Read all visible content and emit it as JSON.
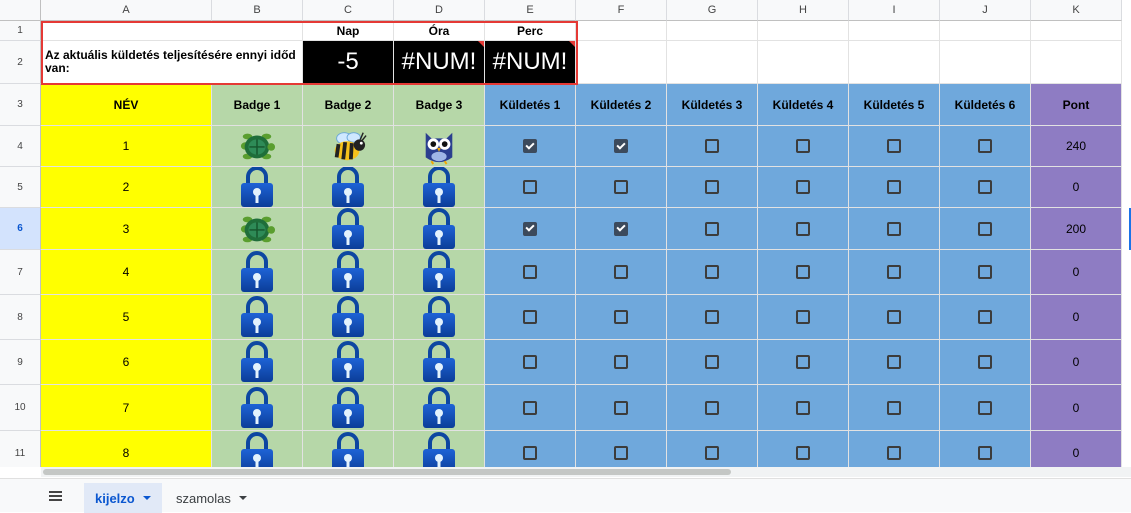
{
  "columns": [
    "A",
    "B",
    "C",
    "D",
    "E",
    "F",
    "G",
    "H",
    "I",
    "J",
    "K"
  ],
  "row_numbers": [
    "1",
    "2",
    "3",
    "4",
    "5",
    "6",
    "7",
    "8",
    "9",
    "10",
    "11"
  ],
  "selected_row": "6",
  "timer": {
    "prompt": "Az aktuális küldetés teljesítésére ennyi időd van:",
    "headers": [
      "Nap",
      "Óra",
      "Perc"
    ],
    "values": [
      "-5",
      "#NUM!",
      "#NUM!"
    ]
  },
  "table_headers": [
    "NÉV",
    "Badge 1",
    "Badge 2",
    "Badge 3",
    "Küldetés 1",
    "Küldetés 2",
    "Küldetés 3",
    "Küldetés 4",
    "Küldetés 5",
    "Küldetés 6",
    "Pont"
  ],
  "rows": [
    {
      "name": "1",
      "badges": [
        "turtle",
        "bee",
        "owl"
      ],
      "missions": [
        true,
        true,
        false,
        false,
        false,
        false
      ],
      "points": "240"
    },
    {
      "name": "2",
      "badges": [
        "lock",
        "lock",
        "lock"
      ],
      "missions": [
        false,
        false,
        false,
        false,
        false,
        false
      ],
      "points": "0"
    },
    {
      "name": "3",
      "badges": [
        "turtle",
        "lock",
        "lock"
      ],
      "missions": [
        true,
        true,
        false,
        false,
        false,
        false
      ],
      "points": "200"
    },
    {
      "name": "4",
      "badges": [
        "lock",
        "lock",
        "lock"
      ],
      "missions": [
        false,
        false,
        false,
        false,
        false,
        false
      ],
      "points": "0"
    },
    {
      "name": "5",
      "badges": [
        "lock",
        "lock",
        "lock"
      ],
      "missions": [
        false,
        false,
        false,
        false,
        false,
        false
      ],
      "points": "0"
    },
    {
      "name": "6",
      "badges": [
        "lock",
        "lock",
        "lock"
      ],
      "missions": [
        false,
        false,
        false,
        false,
        false,
        false
      ],
      "points": "0"
    },
    {
      "name": "7",
      "badges": [
        "lock",
        "lock",
        "lock"
      ],
      "missions": [
        false,
        false,
        false,
        false,
        false,
        false
      ],
      "points": "0"
    },
    {
      "name": "8",
      "badges": [
        "lock",
        "lock",
        "lock"
      ],
      "missions": [
        false,
        false,
        false,
        false,
        false,
        false
      ],
      "points": "0"
    }
  ],
  "colors": {
    "name_col": "#ffff00",
    "badge_col": "#b6d7a8",
    "mission_col": "#6fa8dc",
    "points_col": "#8e7cc3",
    "timer_bg": "#000000",
    "timer_border": "#e53935"
  },
  "sheet_tabs": [
    {
      "label": "kijelzo",
      "active": true
    },
    {
      "label": "szamolas",
      "active": false
    }
  ],
  "icons": {
    "all_sheets": "hamburger-menu-icon",
    "tab_menu": "chevron-down-icon"
  }
}
